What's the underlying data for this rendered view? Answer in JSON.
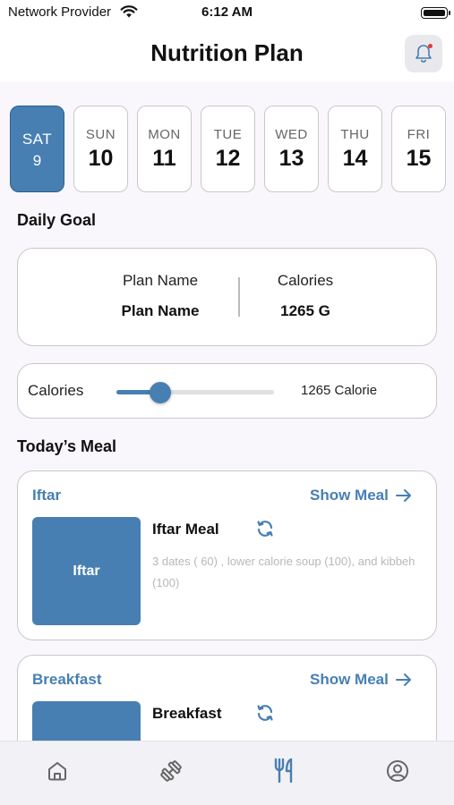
{
  "status_bar": {
    "carrier": "Network Provider",
    "time": "6:12 AM"
  },
  "header": {
    "title": "Nutrition Plan"
  },
  "days": [
    {
      "name": "SAT",
      "number": "9",
      "selected": true
    },
    {
      "name": "SUN",
      "number": "10",
      "selected": false
    },
    {
      "name": "MON",
      "number": "11",
      "selected": false
    },
    {
      "name": "TUE",
      "number": "12",
      "selected": false
    },
    {
      "name": "WED",
      "number": "13",
      "selected": false
    },
    {
      "name": "THU",
      "number": "14",
      "selected": false
    },
    {
      "name": "FRI",
      "number": "15",
      "selected": false
    }
  ],
  "daily_goal": {
    "title": "Daily Goal",
    "plan_label": "Plan Name",
    "plan_value": "Plan Name",
    "calories_label": "Calories",
    "calories_value": "1265 G"
  },
  "calorie_slider": {
    "label": "Calories",
    "value_text": "1265 Calorie",
    "level_fraction": 0.28
  },
  "todays_meal": {
    "title": "Today’s Meal",
    "meals": [
      {
        "type": "Iftar",
        "show_label": "Show Meal",
        "image_label": "Iftar",
        "name": "Iftar Meal",
        "description": "3 dates ( 60) , lower calorie soup (100), and kibbeh (100)"
      },
      {
        "type": "Breakfast",
        "show_label": "Show Meal",
        "image_label": "",
        "name": "Breakfast",
        "description": ""
      }
    ]
  },
  "tab_bar": {
    "tabs": [
      {
        "icon": "home-icon",
        "active": false
      },
      {
        "icon": "dumbbell-icon",
        "active": false
      },
      {
        "icon": "utensils-icon",
        "active": true
      },
      {
        "icon": "profile-icon",
        "active": false
      }
    ]
  },
  "colors": {
    "accent": "#477fb2",
    "background": "#faf7fc",
    "muted_text": "#b8b8bc",
    "notification_dot": "#e53935"
  }
}
